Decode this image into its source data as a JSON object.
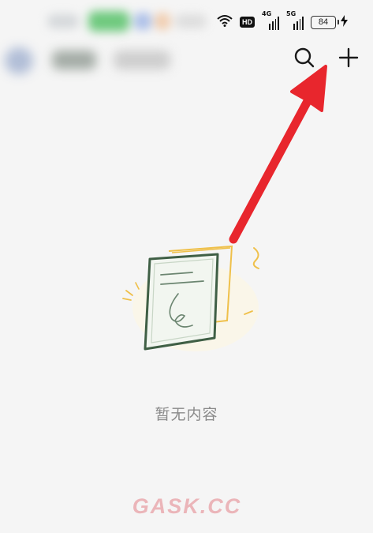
{
  "status_bar": {
    "network_label": "HD",
    "signal_1_label": "4G",
    "signal_2_label": "5G",
    "battery_level": "84"
  },
  "header": {
    "actions": [
      "search-icon",
      "add-icon"
    ]
  },
  "empty_state": {
    "message": "暂无内容",
    "illustration": "empty-document-illustration"
  },
  "annotation": {
    "arrow_color": "#e8262d"
  },
  "watermark": {
    "text": "GASK.CC"
  }
}
